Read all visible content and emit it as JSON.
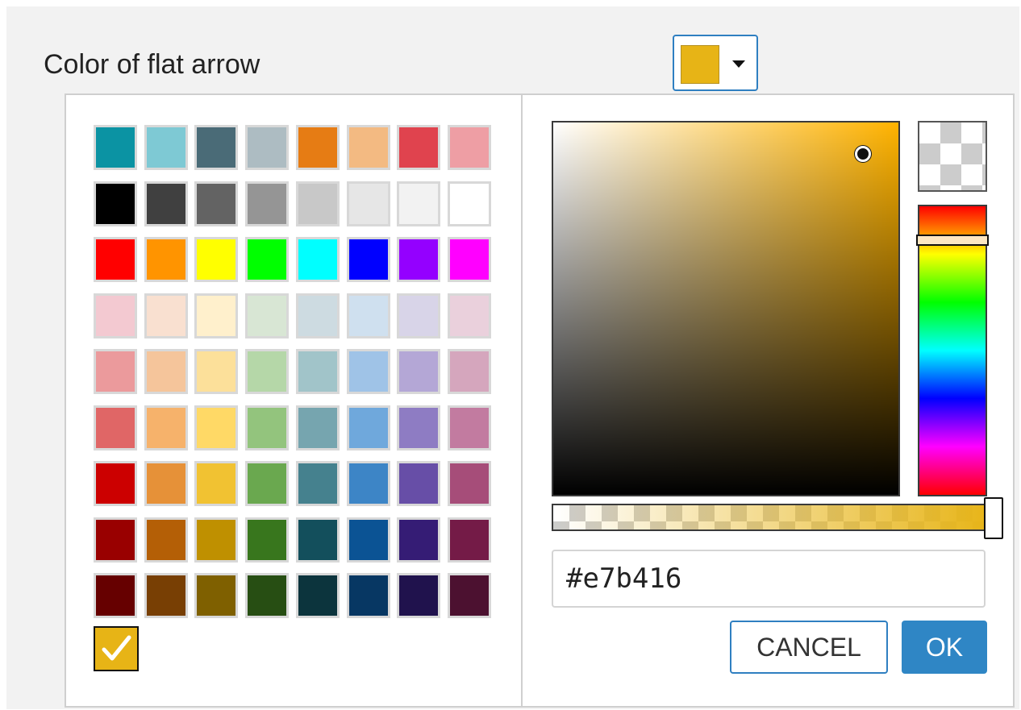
{
  "field": {
    "label": "Color of flat arrow",
    "current_color": "#e7b416"
  },
  "palette": {
    "rows": [
      [
        "#0b93a3",
        "#7ec9d4",
        "#4a6b77",
        "#adbcc2",
        "#e67c14",
        "#f3ba82",
        "#e0434e",
        "#ee9ea4"
      ],
      [
        "#000000",
        "#404040",
        "#636363",
        "#959595",
        "#c8c8c8",
        "#e6e6e6",
        "#f2f2f2",
        "#ffffff"
      ],
      [
        "#ff0000",
        "#ff9400",
        "#ffff00",
        "#00ff00",
        "#00ffff",
        "#0000ff",
        "#9400ff",
        "#ff00ff"
      ],
      [
        "#f3c9d1",
        "#f9e0d0",
        "#fff0cc",
        "#d8e6d4",
        "#cddbe1",
        "#cfe0ef",
        "#d8d4e8",
        "#ead0dc"
      ],
      [
        "#eb9a9c",
        "#f5c59b",
        "#fce09a",
        "#b5d7a8",
        "#a1c4c9",
        "#9fc3e7",
        "#b4a7d6",
        "#d5a6bd"
      ],
      [
        "#e06666",
        "#f6b26b",
        "#ffd966",
        "#93c47d",
        "#76a5af",
        "#6fa8dc",
        "#8e7cc3",
        "#c27ba0"
      ],
      [
        "#cc0000",
        "#e69138",
        "#f1c232",
        "#6aa84f",
        "#45818e",
        "#3d85c6",
        "#674ea7",
        "#a64d79"
      ],
      [
        "#990000",
        "#b45f06",
        "#bf9000",
        "#38761d",
        "#134f5c",
        "#0b5394",
        "#351c75",
        "#741b47"
      ],
      [
        "#660000",
        "#783f04",
        "#7f6000",
        "#274e13",
        "#0c343d",
        "#073763",
        "#20124d",
        "#4c1130"
      ]
    ],
    "selected_color": "#e7b416"
  },
  "picker": {
    "hue_color": "#ffb300",
    "hex_value": "#e7b416",
    "cancel_label": "CANCEL",
    "ok_label": "OK"
  },
  "icons": {
    "dropdown": "caret-down-icon",
    "selected": "checkmark-icon"
  }
}
